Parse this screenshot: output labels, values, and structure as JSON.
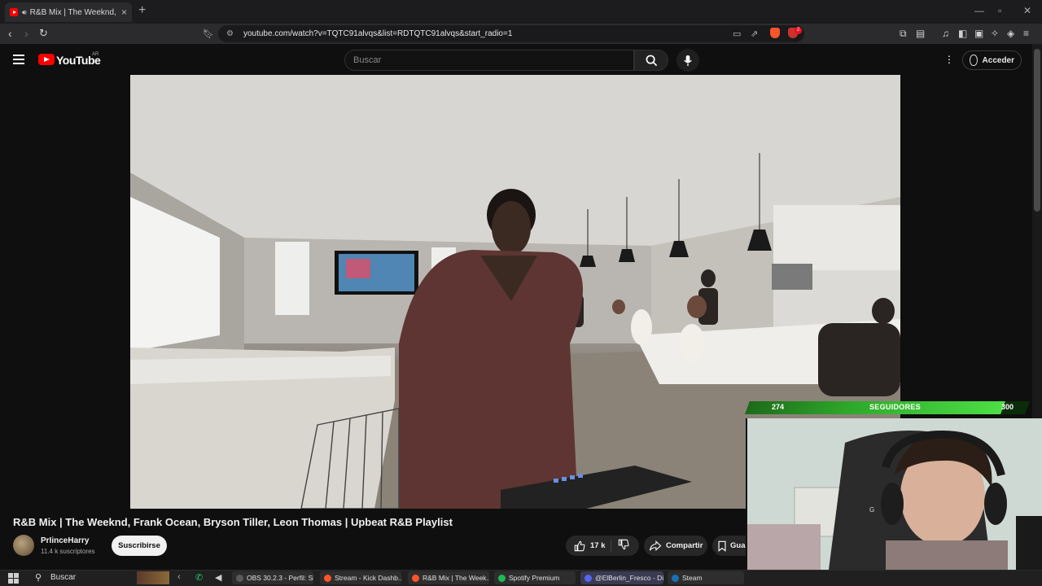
{
  "browser": {
    "tab_title": "R&B Mix | The Weeknd, Frank",
    "url": "youtube.com/watch?v=TQTC91alvqs&list=RDTQTC91alvqs&start_radio=1",
    "brave_badge": "2"
  },
  "youtube": {
    "logo_text": "YouTube",
    "country_code": "AR",
    "search_placeholder": "Buscar",
    "signin_label": "Acceder"
  },
  "video": {
    "title": "R&B Mix | The Weeknd, Frank Ocean, Bryson Tiller, Leon Thomas | Upbeat R&B Playlist",
    "channel_name": "PrIinceHarry",
    "subscribers": "11.4 k suscriptores",
    "subscribe_label": "Suscribirse",
    "likes": "17 k",
    "share_label": "Compartir",
    "save_label": "Gua"
  },
  "overlay": {
    "followers_current": "274",
    "followers_label": "SEGUIDORES",
    "followers_goal": "300",
    "followers_progress": 0.913
  },
  "taskbar": {
    "search_label": "Buscar",
    "items": [
      {
        "label": "OBS 30.2.3 - Perfil: Si...",
        "color": "#5a5a5a"
      },
      {
        "label": "Stream - Kick Dashb...",
        "color": "#fb542b"
      },
      {
        "label": "R&B Mix | The Week...",
        "color": "#fb542b"
      },
      {
        "label": "Spotify Premium",
        "color": "#1db954"
      },
      {
        "label": "@ElBerlin_Fresco - Di...",
        "color": "#5865f2"
      },
      {
        "label": "Steam",
        "color": "#1b6fb5"
      }
    ]
  }
}
